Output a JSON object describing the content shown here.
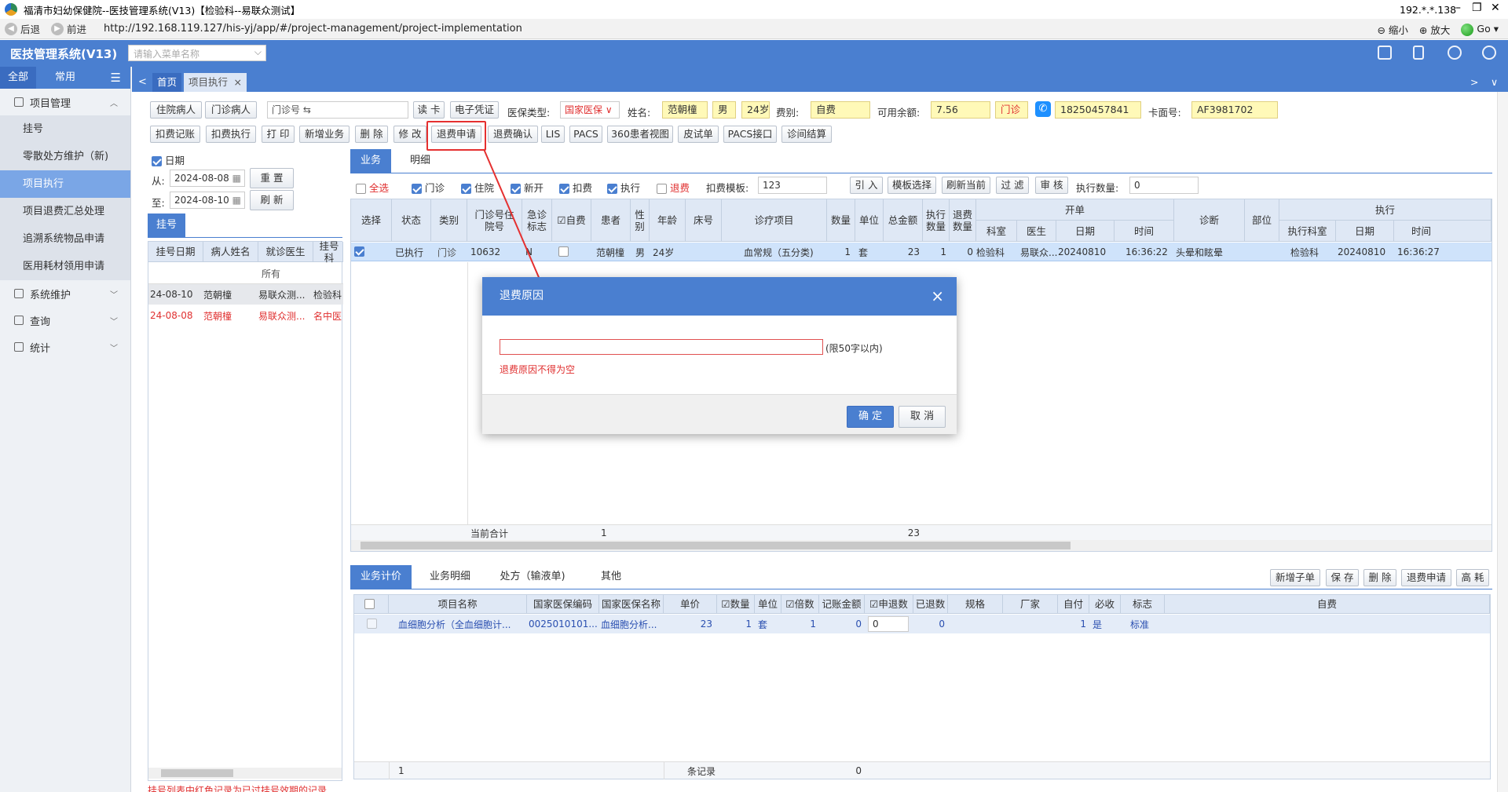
{
  "window": {
    "title": "福清市妇幼保健院--医技管理系统(V13)【检验科--易联众测试】",
    "ip": "192.*.*.138",
    "min": "–",
    "restore": "❐",
    "close": "✕"
  },
  "browser": {
    "back": "后退",
    "forward": "前进",
    "url": "http://192.168.119.127/his-yj/app/#/project-management/project-implementation",
    "zoom_out": "缩小",
    "zoom_in": "放大",
    "go": "Go"
  },
  "app": {
    "brand": "医技管理系统(V13)",
    "menu_search_placeholder": "请输入菜单名称"
  },
  "sidebar": {
    "tabs": [
      "全部",
      "常用"
    ],
    "group_project": "项目管理",
    "items": [
      "挂号",
      "零散处方维护（新)",
      "项目执行",
      "项目退费汇总处理",
      "追溯系统物品申请",
      "医用耗材领用申请"
    ],
    "group_system": "系统维护",
    "group_query": "查询",
    "group_stats": "统计"
  },
  "content_tabs": {
    "home": "首页",
    "current": "项目执行",
    "close": "×"
  },
  "toolbar1": {
    "inpatient": "住院病人",
    "outpatient": "门诊病人",
    "outpatient_no": "门诊号",
    "read_card": "读 卡",
    "e_voucher": "电子凭证",
    "insurance_type_label": "医保类型:",
    "insurance_type_value": "国家医保",
    "name_label": "姓名:",
    "name_value": "范朝橦",
    "gender": "男",
    "age": "24岁",
    "fee_type_label": "费别:",
    "fee_type_value": "自费",
    "balance_label": "可用余额:",
    "balance_value": "7.56",
    "visit_type": "门诊",
    "phone": "18250457841",
    "card_label": "卡面号:",
    "card_value": "AF3981702"
  },
  "toolbar2": [
    "扣费记账",
    "扣费执行",
    "打 印",
    "新增业务",
    "删 除",
    "修 改",
    "退费申请",
    "退费确认",
    "LIS",
    "PACS",
    "360患者视图",
    "皮试单",
    "PACS接口",
    "诊间结算"
  ],
  "left_panel": {
    "date_label": "日期",
    "from_label": "从:",
    "from_value": "2024-08-08",
    "to_label": "至:",
    "to_value": "2024-08-10",
    "reset": "重 置",
    "refresh": "刷 新",
    "tab": "挂号",
    "columns": [
      "挂号日期",
      "病人姓名",
      "就诊医生",
      "挂号科"
    ],
    "filter_all": "所有",
    "rows": [
      {
        "date": "24-08-10",
        "name": "范朝橦",
        "doctor": "易联众测...",
        "dept": "检验科",
        "red": false
      },
      {
        "date": "24-08-08",
        "name": "范朝橦",
        "doctor": "易联众测...",
        "dept": "名中医",
        "red": true
      }
    ],
    "note": "挂号列表中红色记录为已过挂号效期的记录"
  },
  "main": {
    "tabs": [
      "业务",
      "明细"
    ],
    "filters": {
      "all": "全选",
      "outpatient": "门诊",
      "inpatient": "住院",
      "new": "新开",
      "deduct": "扣费",
      "execute": "执行",
      "refund": "退费"
    },
    "template_label": "扣费模板:",
    "template_value": "123",
    "btn_import": "引 入",
    "btn_template": "模板选择",
    "btn_refresh_current": "刷新当前",
    "btn_filter": "过 滤",
    "btn_audit": "审 核",
    "exec_count_label": "执行数量:",
    "exec_count_value": "0",
    "headers": {
      "select": "选择",
      "status": "状态",
      "category": "类别",
      "visit_no": "门诊号住院号",
      "urgent": "急诊标志",
      "self_pay": "自费",
      "patient": "患者",
      "gender": "性别",
      "age": "年龄",
      "bed": "床号",
      "item": "诊疗项目",
      "qty": "数量",
      "unit": "单位",
      "total": "总金额",
      "exec_qty": "执行数量",
      "refund_qty": "退费数量",
      "order_group": "开单",
      "dept": "科室",
      "doctor": "医生",
      "date": "日期",
      "time": "时间",
      "diagnosis": "诊断",
      "site": "部位",
      "exec_group": "执行",
      "exec_dept": "执行科室",
      "exec_date": "日期",
      "exec_time": "时间"
    },
    "row": {
      "status": "已执行",
      "category": "门诊",
      "visit_no": "10632",
      "urgent": "N",
      "patient": "范朝橦",
      "gender": "男",
      "age": "24岁",
      "bed": "",
      "item": "血常规（五分类)",
      "qty": "1",
      "unit": "套",
      "total": "23",
      "exec_qty": "1",
      "refund_qty": "0",
      "dept": "检验科",
      "doctor": "易联众...",
      "date": "20240810",
      "time": "16:36:22",
      "diagnosis": "头晕和眩晕",
      "site": "",
      "exec_dept": "检验科",
      "exec_date": "20240810",
      "exec_time": "16:36:27"
    },
    "summary_label": "当前合计",
    "summary_count": "1",
    "summary_total": "23"
  },
  "bottom": {
    "tabs": [
      "业务计价",
      "业务明细",
      "处方（输液单)",
      "其他"
    ],
    "buttons": [
      "新增子单",
      "保 存",
      "删 除",
      "退费申请",
      "高 耗"
    ],
    "headers": [
      "项目名称",
      "国家医保编码",
      "国家医保名称",
      "单价",
      "数量",
      "单位",
      "倍数",
      "记账金额",
      "申退数",
      "已退数",
      "规格",
      "厂家",
      "自付",
      "必收",
      "标志",
      "自费"
    ],
    "row": {
      "name": "血细胞分析（全血细胞计...",
      "code": "0025010101...",
      "ins_name": "血细胞分析...",
      "price": "23",
      "qty": "1",
      "unit": "套",
      "multiple": "1",
      "amount": "0",
      "refund_apply": "0",
      "refunded": "0",
      "spec": "",
      "vendor": "",
      "self_pay": "1",
      "required": "是",
      "flag": "标准",
      "self_fee": ""
    },
    "footer_count": "1",
    "footer_label": "条记录",
    "footer_total": "0"
  },
  "modal": {
    "title": "退费原因",
    "close": "×",
    "input_value": "",
    "hint": "(限50字以内)",
    "error": "退费原因不得为空",
    "confirm": "确 定",
    "cancel": "取 消"
  },
  "colors": {
    "accent": "#4a7fd0",
    "highlight_row": "#cfe3fb",
    "error": "#e03030",
    "yellow_field": "#fff9b8"
  }
}
